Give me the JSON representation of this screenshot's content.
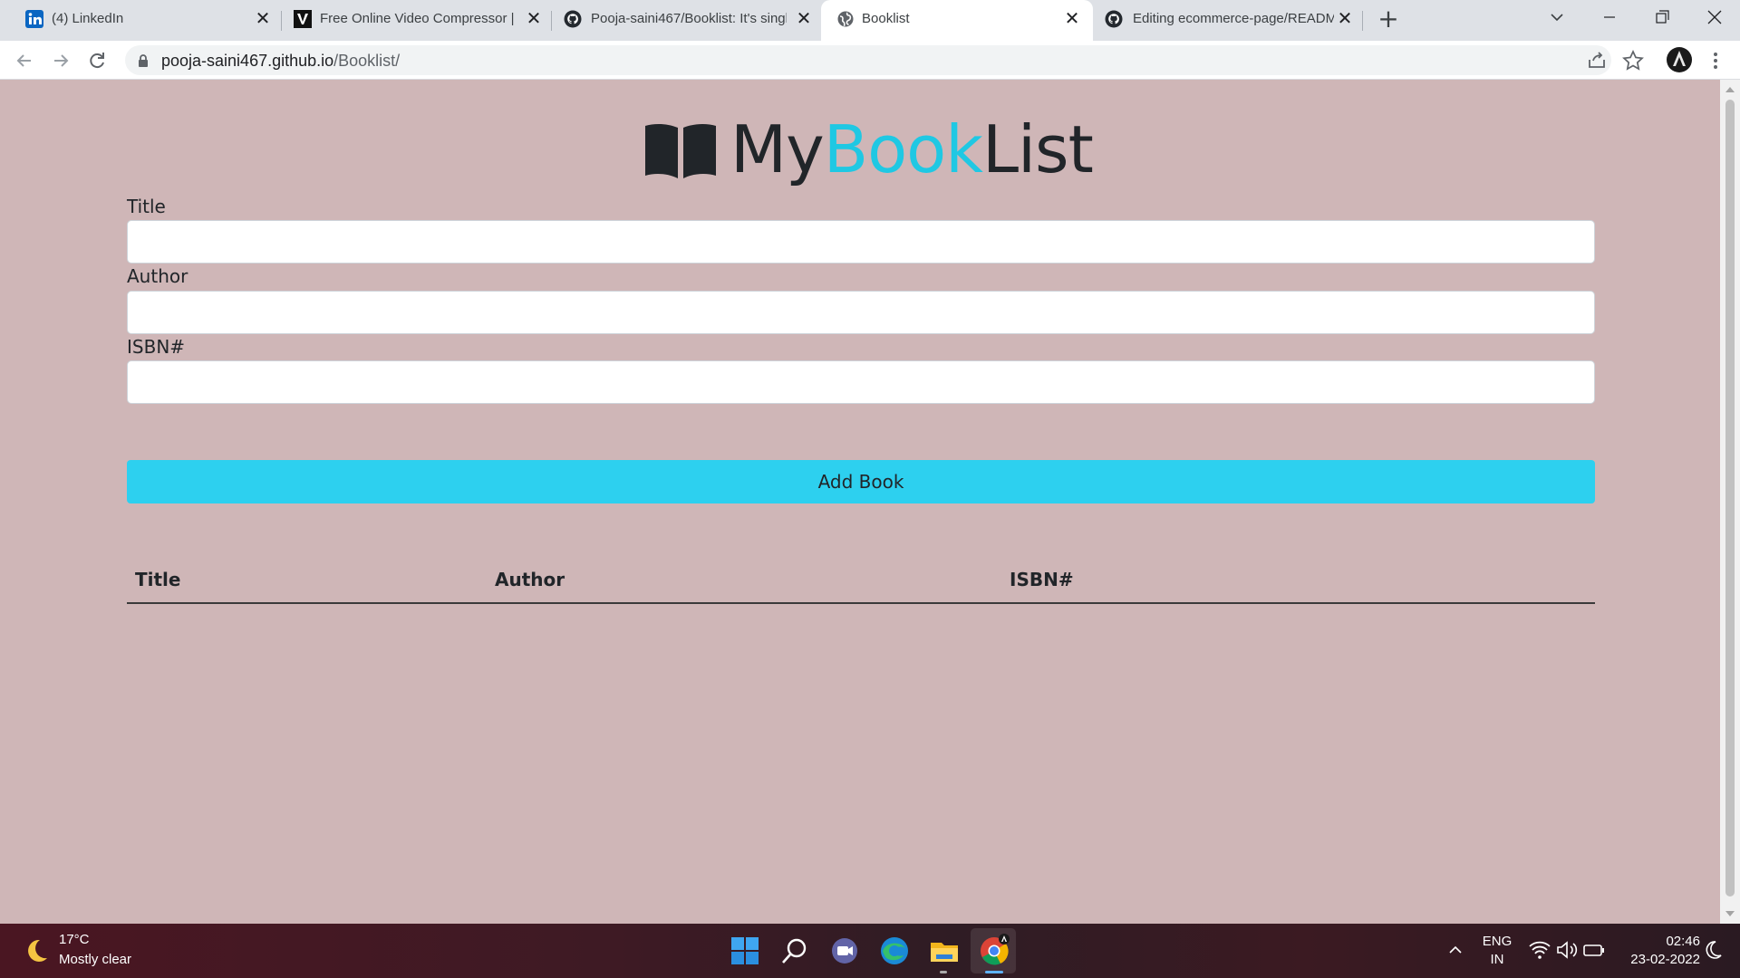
{
  "browser": {
    "tabs": [
      {
        "title": "(4) LinkedIn",
        "favicon": "linkedin-icon",
        "active": false
      },
      {
        "title": "Free Online Video Compressor | V",
        "favicon": "v-logo-icon",
        "active": false
      },
      {
        "title": "Pooja-saini467/Booklist: It's singl",
        "favicon": "github-icon",
        "active": false
      },
      {
        "title": "Booklist",
        "favicon": "globe-icon",
        "active": true
      },
      {
        "title": "Editing ecommerce-page/READM",
        "favicon": "github-icon",
        "active": false
      }
    ],
    "close_glyph": "✕",
    "new_tab_glyph": "+",
    "address": {
      "host": "pooja-saini467.github.io",
      "path": "/Booklist/"
    }
  },
  "page": {
    "brand": {
      "part1": "My",
      "part2": "Book",
      "part3": "List",
      "accent_color": "#1fc8e3"
    },
    "form": {
      "title_label": "Title",
      "title_value": "",
      "author_label": "Author",
      "author_value": "",
      "isbn_label": "ISBN#",
      "isbn_value": "",
      "submit_label": "Add Book"
    },
    "table": {
      "headers": [
        "Title",
        "Author",
        "ISBN#"
      ],
      "rows": []
    },
    "background_color": "#cfb6b7"
  },
  "taskbar": {
    "weather": {
      "temp": "17°C",
      "desc": "Mostly clear"
    },
    "language": {
      "line1": "ENG",
      "line2": "IN"
    },
    "clock": {
      "time": "02:46",
      "date": "23-02-2022"
    }
  }
}
